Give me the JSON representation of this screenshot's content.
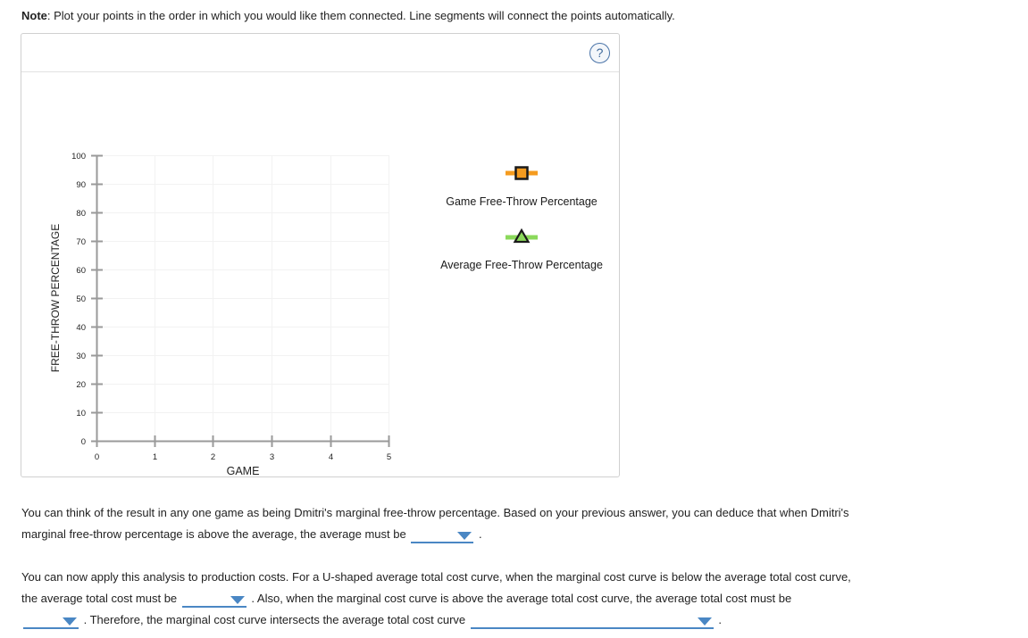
{
  "note": {
    "label": "Note",
    "text": ": Plot your points in the order in which you would like them connected. Line segments will connect the points automatically."
  },
  "chart_panel": {
    "help_icon": "question-mark-icon",
    "help_label": "?"
  },
  "chart_data": {
    "type": "scatter",
    "title": "",
    "xlabel": "GAME",
    "ylabel": "FREE-THROW PERCENTAGE",
    "xlim": [
      0,
      5
    ],
    "ylim": [
      0,
      100
    ],
    "xticks": [
      "0",
      "1",
      "2",
      "3",
      "4",
      "5"
    ],
    "yticks": [
      "0",
      "10",
      "20",
      "30",
      "40",
      "50",
      "60",
      "70",
      "80",
      "90",
      "100"
    ],
    "grid": true,
    "legend_position": "right",
    "series": [
      {
        "name": "Game Free-Throw Percentage",
        "marker": "square",
        "color": "#f59b1e",
        "marker_edge": "#1a1a1a",
        "x": [],
        "y": []
      },
      {
        "name": "Average Free-Throw Percentage",
        "marker": "triangle",
        "color": "#8bd95b",
        "marker_edge": "#1a1a1a",
        "x": [],
        "y": []
      }
    ]
  },
  "paragraph_1": {
    "part_1": "You can think of the result in any one game as being Dmitri's marginal free-throw percentage. Based on your previous answer, you can deduce that when Dmitri's marginal free-throw percentage is above the average, the average must be",
    "dropdown_1_value": "",
    "part_2": "."
  },
  "paragraph_2": {
    "part_1": "You can now apply this analysis to production costs. For a U-shaped average total cost curve, when the marginal cost curve is below the average total cost curve, the average total cost must be",
    "dropdown_1_value": "",
    "part_2": ". Also, when the marginal cost curve is above the average total cost curve, the average total cost must be",
    "dropdown_2_value": "",
    "part_3": ". Therefore, the marginal cost curve intersects the average total cost curve",
    "dropdown_3_value": "",
    "part_4": "."
  },
  "colors": {
    "accent_blue": "#4a87c4",
    "series_orange": "#f59b1e",
    "series_green": "#8bd95b",
    "axis_gray": "#999999",
    "grid_gray": "#f2f2f2"
  }
}
